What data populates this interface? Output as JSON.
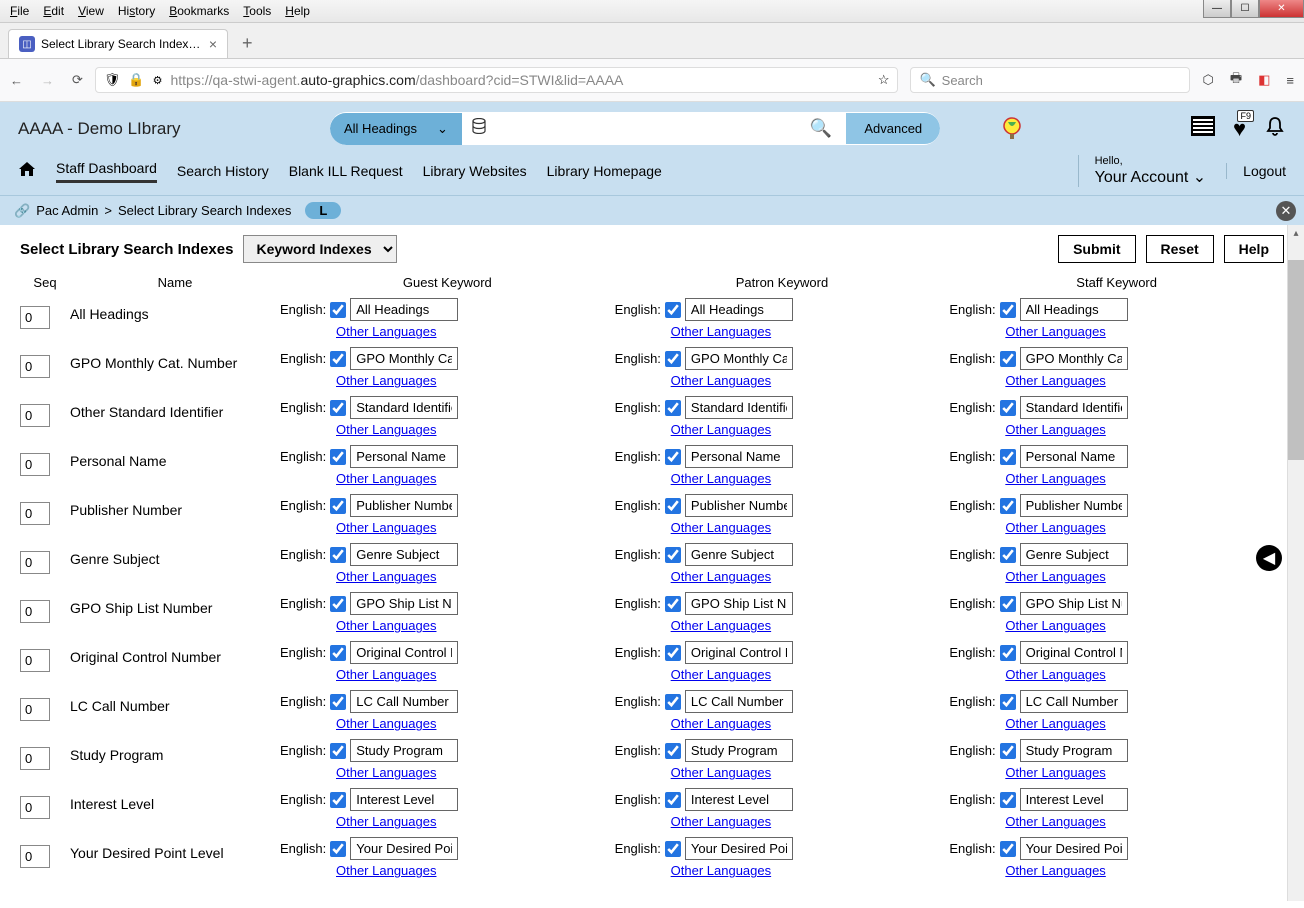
{
  "browser": {
    "menus": [
      "File",
      "Edit",
      "View",
      "History",
      "Bookmarks",
      "Tools",
      "Help"
    ],
    "tab_title": "Select Library Search Indexes | S",
    "url_prefix": "https://qa-stwi-agent.",
    "url_domain": "auto-graphics.com",
    "url_path": "/dashboard?cid=STWI&lid=AAAA",
    "search_placeholder": "Search"
  },
  "header": {
    "library_name": "AAAA - Demo LIbrary",
    "dropdown_label": "All Headings",
    "advanced_label": "Advanced",
    "fav_badge": "F9"
  },
  "topnav": {
    "items": [
      "Staff Dashboard",
      "Search History",
      "Blank ILL Request",
      "Library Websites",
      "Library Homepage"
    ],
    "hello": "Hello,",
    "account": "Your Account",
    "logout": "Logout"
  },
  "breadcrumb": {
    "part1": "Pac Admin",
    "part2": "Select Library Search Indexes",
    "badge": "L"
  },
  "page": {
    "title": "Select Library Search Indexes",
    "dropdown": "Keyword Indexes",
    "submit": "Submit",
    "reset": "Reset",
    "help": "Help",
    "col_seq": "Seq",
    "col_name": "Name",
    "col_guest": "Guest Keyword",
    "col_patron": "Patron Keyword",
    "col_staff": "Staff Keyword",
    "english_label": "English:",
    "other_lang": "Other Languages"
  },
  "rows": [
    {
      "seq": "0",
      "name": "All Headings",
      "val": "All Headings"
    },
    {
      "seq": "0",
      "name": "GPO Monthly Cat. Number",
      "val": "GPO Monthly Cat."
    },
    {
      "seq": "0",
      "name": "Other Standard Identifier",
      "val": "Standard Identifie"
    },
    {
      "seq": "0",
      "name": "Personal Name",
      "val": "Personal Name"
    },
    {
      "seq": "0",
      "name": "Publisher Number",
      "val": "Publisher Number"
    },
    {
      "seq": "0",
      "name": "Genre Subject",
      "val": "Genre Subject"
    },
    {
      "seq": "0",
      "name": "GPO Ship List Number",
      "val": "GPO Ship List Num"
    },
    {
      "seq": "0",
      "name": "Original Control Number",
      "val": "Original Control N"
    },
    {
      "seq": "0",
      "name": "LC Call Number",
      "val": "LC Call Number"
    },
    {
      "seq": "0",
      "name": "Study Program",
      "val": "Study Program"
    },
    {
      "seq": "0",
      "name": "Interest Level",
      "val": "Interest Level"
    },
    {
      "seq": "0",
      "name": "Your Desired Point Level",
      "val": "Your Desired Poin"
    }
  ]
}
